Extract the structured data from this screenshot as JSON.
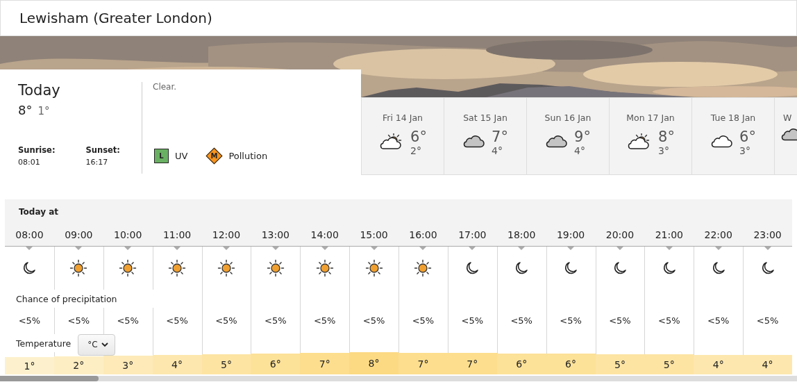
{
  "location": {
    "title": "Lewisham (Greater London)"
  },
  "today": {
    "label": "Today",
    "high": "8°",
    "low": "1°",
    "sunrise_label": "Sunrise:",
    "sunrise": "08:01",
    "sunset_label": "Sunset:",
    "sunset": "16:17",
    "summary": "Clear.",
    "indicators": [
      {
        "kind": "square",
        "badge": "L",
        "label": "UV",
        "color": "#6ab063"
      },
      {
        "kind": "diamond",
        "badge": "M",
        "label": "Pollution",
        "color": "#f7941d"
      }
    ]
  },
  "days": [
    {
      "date": "Fri 14 Jan",
      "kind": "sun-cloud",
      "high": "6°",
      "low": "2°"
    },
    {
      "date": "Sat 15 Jan",
      "kind": "grey-cloud",
      "high": "7°",
      "low": "4°"
    },
    {
      "date": "Sun 16 Jan",
      "kind": "grey-cloud",
      "high": "9°",
      "low": "4°"
    },
    {
      "date": "Mon 17 Jan",
      "kind": "sun-cloud",
      "high": "8°",
      "low": "3°"
    },
    {
      "date": "Tue 18 Jan",
      "kind": "white-cloud",
      "high": "6°",
      "low": "3°"
    },
    {
      "date": "W",
      "kind": "grey-cloud"
    }
  ],
  "hourly": {
    "title": "Today at",
    "precip_label": "Chance of precipitation",
    "temp_label": "Temperature",
    "unit": "°C",
    "hours": [
      {
        "time": "08:00",
        "kind": "moon",
        "precip": "<5%",
        "temp": "1°"
      },
      {
        "time": "09:00",
        "kind": "sun",
        "precip": "<5%",
        "temp": "2°"
      },
      {
        "time": "10:00",
        "kind": "sun",
        "precip": "<5%",
        "temp": "3°"
      },
      {
        "time": "11:00",
        "kind": "sun",
        "precip": "<5%",
        "temp": "4°"
      },
      {
        "time": "12:00",
        "kind": "sun",
        "precip": "<5%",
        "temp": "5°"
      },
      {
        "time": "13:00",
        "kind": "sun",
        "precip": "<5%",
        "temp": "6°"
      },
      {
        "time": "14:00",
        "kind": "sun",
        "precip": "<5%",
        "temp": "7°"
      },
      {
        "time": "15:00",
        "kind": "sun",
        "precip": "<5%",
        "temp": "8°"
      },
      {
        "time": "16:00",
        "kind": "sun",
        "precip": "<5%",
        "temp": "7°"
      },
      {
        "time": "17:00",
        "kind": "moon",
        "precip": "<5%",
        "temp": "7°"
      },
      {
        "time": "18:00",
        "kind": "moon",
        "precip": "<5%",
        "temp": "6°"
      },
      {
        "time": "19:00",
        "kind": "moon",
        "precip": "<5%",
        "temp": "6°"
      },
      {
        "time": "20:00",
        "kind": "moon",
        "precip": "<5%",
        "temp": "5°"
      },
      {
        "time": "21:00",
        "kind": "moon",
        "precip": "<5%",
        "temp": "5°"
      },
      {
        "time": "22:00",
        "kind": "moon",
        "precip": "<5%",
        "temp": "4°"
      },
      {
        "time": "23:00",
        "kind": "moon",
        "precip": "<5%",
        "temp": "4°"
      }
    ]
  }
}
